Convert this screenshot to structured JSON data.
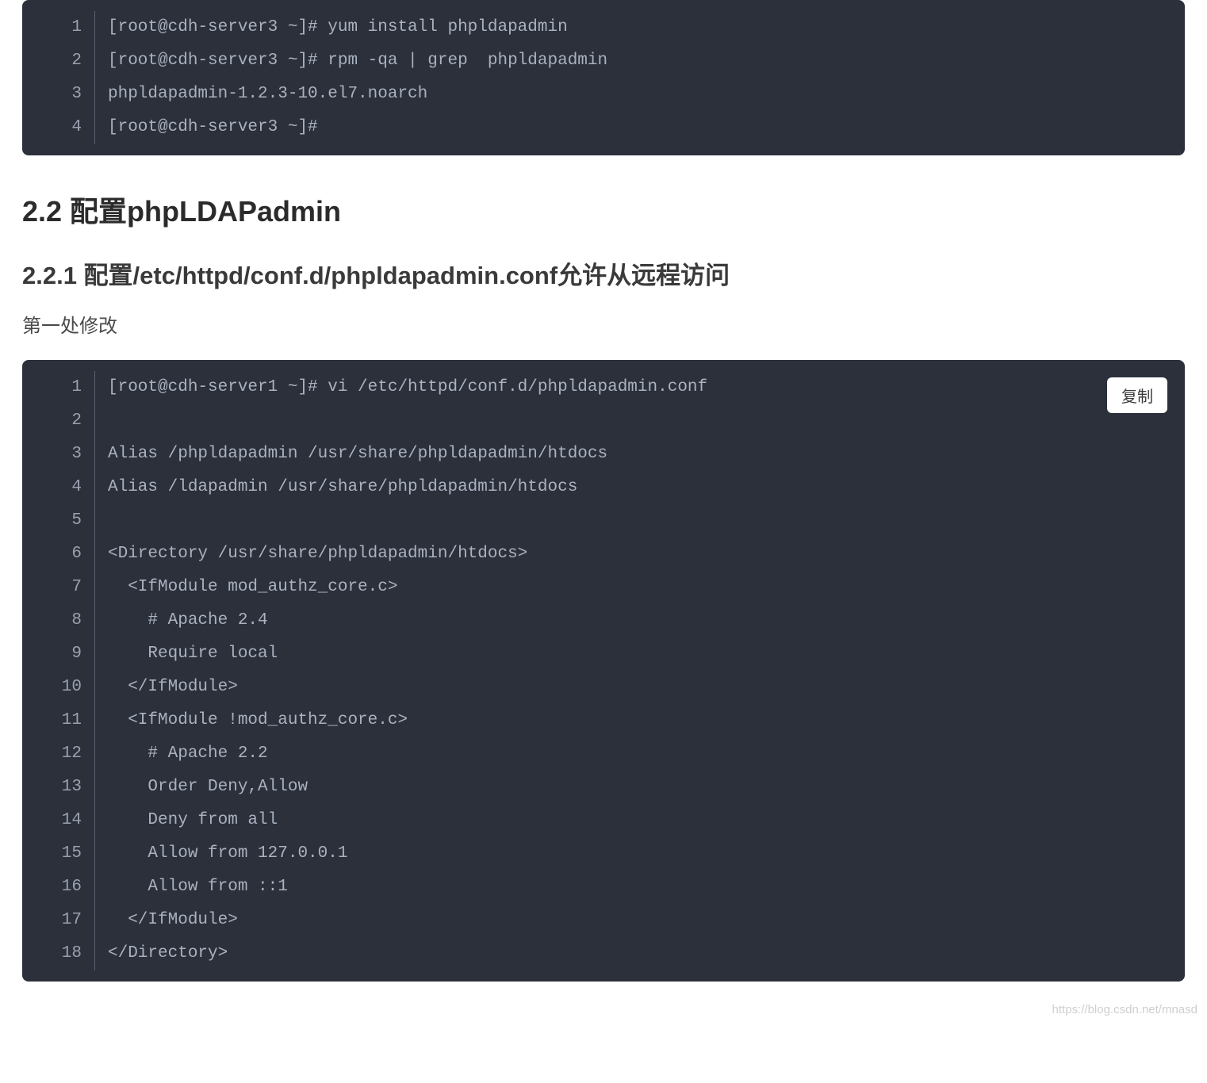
{
  "codeBlock1": {
    "lineNumbers": [
      "1",
      "2",
      "3",
      "4"
    ],
    "lines": [
      "[root@cdh-server3 ~]# yum install phpldapadmin",
      "[root@cdh-server3 ~]# rpm -qa | grep  phpldapadmin",
      "phpldapadmin-1.2.3-10.el7.noarch",
      "[root@cdh-server3 ~]#"
    ]
  },
  "heading1": "2.2 配置phpLDAPadmin",
  "heading2": "2.2.1 配置/etc/httpd/conf.d/phpldapadmin.conf允许从远程访问",
  "bodyText": "第一处修改",
  "copyButtonLabel": "复制",
  "codeBlock2": {
    "lineNumbers": [
      "1",
      "2",
      "3",
      "4",
      "5",
      "6",
      "7",
      "8",
      "9",
      "10",
      "11",
      "12",
      "13",
      "14",
      "15",
      "16",
      "17",
      "18"
    ],
    "lines": [
      "[root@cdh-server1 ~]# vi /etc/httpd/conf.d/phpldapadmin.conf",
      "",
      "Alias /phpldapadmin /usr/share/phpldapadmin/htdocs",
      "Alias /ldapadmin /usr/share/phpldapadmin/htdocs",
      "",
      "<Directory /usr/share/phpldapadmin/htdocs>",
      "  <IfModule mod_authz_core.c>",
      "    # Apache 2.4",
      "    Require local",
      "  </IfModule>",
      "  <IfModule !mod_authz_core.c>",
      "    # Apache 2.2",
      "    Order Deny,Allow",
      "    Deny from all",
      "    Allow from 127.0.0.1",
      "    Allow from ::1",
      "  </IfModule>",
      "</Directory>"
    ]
  },
  "watermark": "https://blog.csdn.net/mnasd"
}
